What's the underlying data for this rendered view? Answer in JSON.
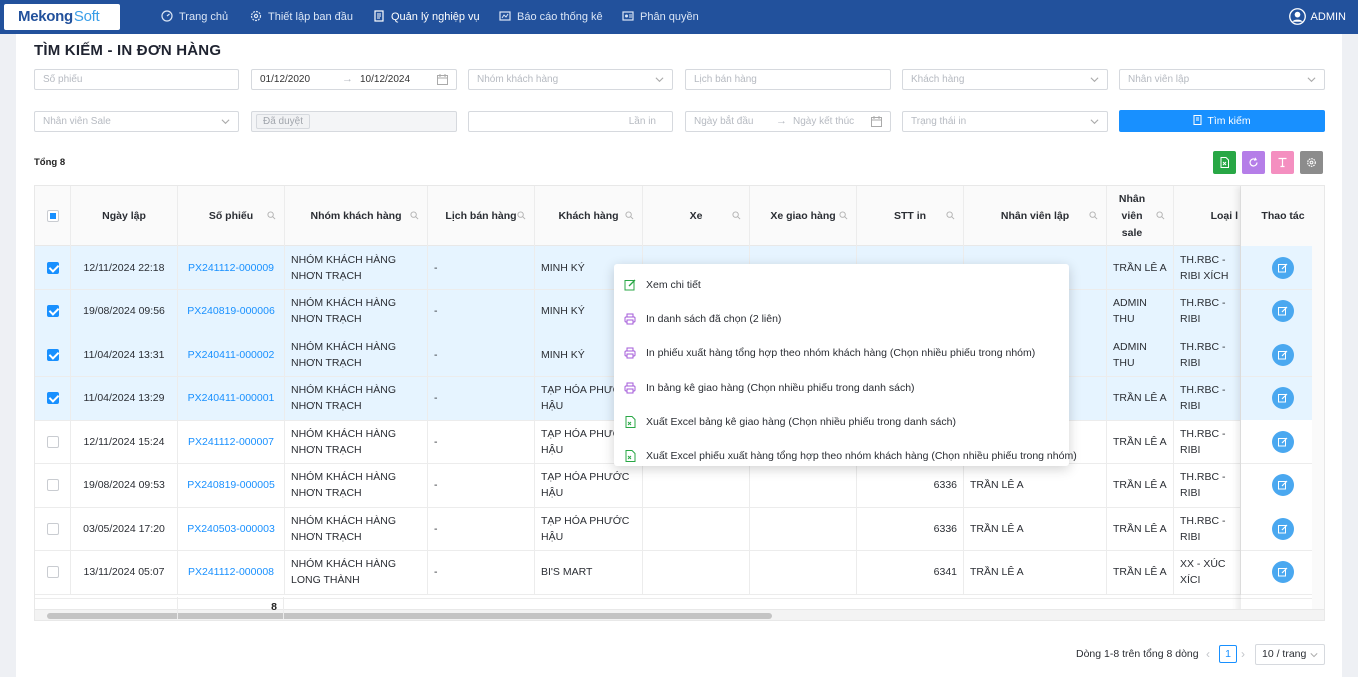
{
  "app": {
    "logo_main": "Mekong",
    "logo_soft": "Soft",
    "user": "ADMIN"
  },
  "nav": [
    {
      "label": "Trang chủ",
      "icon": "dashboard-icon"
    },
    {
      "label": "Thiết lập ban đầu",
      "icon": "settings-icon"
    },
    {
      "label": "Quản lý nghiệp vụ",
      "icon": "document-icon",
      "active": true
    },
    {
      "label": "Báo cáo thống kê",
      "icon": "report-icon"
    },
    {
      "label": "Phân quyền",
      "icon": "permission-icon"
    }
  ],
  "page": {
    "title": "TÌM KIẾM - IN ĐƠN HÀNG"
  },
  "filters": {
    "so_phieu": "Số phiếu",
    "date_from": "01/12/2020",
    "date_to": "10/12/2024",
    "nhom_khach_hang": "Nhóm khách hàng",
    "lich_ban_hang": "Lịch bán hàng",
    "khach_hang": "Khách hàng",
    "nhan_vien_lap": "Nhân viên lập",
    "nhan_vien_sale": "Nhân viên Sale",
    "trang_thai_duyet": "Đã duyệt",
    "lan_in": "Lần in",
    "ngay_bat_dau": "Ngày bắt đầu",
    "ngay_ket_thuc": "Ngày kết thúc",
    "trang_thai_in": "Trạng thái in",
    "search_button": "Tìm kiếm"
  },
  "summary": {
    "total_label": "Tổng 8"
  },
  "toolbar": {
    "colors": {
      "excel": "#28a745",
      "refresh": "#b57ee8",
      "text": "#f48fc0",
      "settings": "#8c8c8c"
    }
  },
  "table": {
    "headers": {
      "ngay_lap": "Ngày lập",
      "so_phieu": "Số phiếu",
      "nhom_khach_hang": "Nhóm khách hàng",
      "lich_ban_hang": "Lịch bán hàng",
      "khach_hang": "Khách hàng",
      "xe": "Xe",
      "xe_giao_hang": "Xe giao hàng",
      "stt_in": "STT in",
      "nhan_vien_lap": "Nhân viên lập",
      "nhan_vien_sale_1": "Nhân",
      "nhan_vien_sale_2": "viên",
      "nhan_vien_sale_3": "sale",
      "loai": "Loại l",
      "thao_tac": "Thao tác"
    },
    "rows": [
      {
        "checked": true,
        "ngay_lap": "12/11/2024 22:18",
        "so_phieu": "PX241112-000009",
        "nhom": "NHÓM KHÁCH HÀNG NHƠN TRẠCH",
        "lich": "-",
        "khach_hang": "MINH KÝ",
        "stt_in": "",
        "nv_lap": "",
        "nv_sale": "TRẦN LÊ A",
        "loai": "TH.RBC - RIBI XÍCH"
      },
      {
        "checked": true,
        "ngay_lap": "19/08/2024 09:56",
        "so_phieu": "PX240819-000006",
        "nhom": "NHÓM KHÁCH HÀNG NHƠN TRẠCH",
        "lich": "-",
        "khach_hang": "MINH KÝ",
        "stt_in": "",
        "nv_lap": "",
        "nv_sale": "ADMIN THU",
        "loai": "TH.RBC - RIBI"
      },
      {
        "checked": true,
        "ngay_lap": "11/04/2024 13:31",
        "so_phieu": "PX240411-000002",
        "nhom": "NHÓM KHÁCH HÀNG NHƠN TRẠCH",
        "lich": "-",
        "khach_hang": "MINH KÝ",
        "stt_in": "",
        "nv_lap": "",
        "nv_sale": "ADMIN THU",
        "loai": "TH.RBC - RIBI"
      },
      {
        "checked": true,
        "ngay_lap": "11/04/2024 13:29",
        "so_phieu": "PX240411-000001",
        "nhom": "NHÓM KHÁCH HÀNG NHƠN TRẠCH",
        "lich": "-",
        "khach_hang": "TẠP HÓA PHƯỚC HẬU",
        "stt_in": "",
        "nv_lap": "",
        "nv_sale": "TRẦN LÊ A",
        "loai": "TH.RBC - RIBI"
      },
      {
        "checked": false,
        "ngay_lap": "12/11/2024 15:24",
        "so_phieu": "PX241112-000007",
        "nhom": "NHÓM KHÁCH HÀNG NHƠN TRẠCH",
        "lich": "-",
        "khach_hang": "TẠP HÓA PHƯỚC HẬU",
        "stt_in": "",
        "nv_lap": "",
        "nv_sale": "TRẦN LÊ A",
        "loai": "TH.RBC - RIBI"
      },
      {
        "checked": false,
        "ngay_lap": "19/08/2024 09:53",
        "so_phieu": "PX240819-000005",
        "nhom": "NHÓM KHÁCH HÀNG NHƠN TRẠCH",
        "lich": "-",
        "khach_hang": "TẠP HÓA PHƯỚC HẬU",
        "stt_in": "6336",
        "nv_lap": "TRẦN LÊ A",
        "nv_sale": "TRẦN LÊ A",
        "loai": "TH.RBC - RIBI"
      },
      {
        "checked": false,
        "ngay_lap": "03/05/2024 17:20",
        "so_phieu": "PX240503-000003",
        "nhom": "NHÓM KHÁCH HÀNG NHƠN TRẠCH",
        "lich": "-",
        "khach_hang": "TẠP HÓA PHƯỚC HẬU",
        "stt_in": "6336",
        "nv_lap": "TRẦN LÊ A",
        "nv_sale": "TRẦN LÊ A",
        "loai": "TH.RBC - RIBI"
      },
      {
        "checked": false,
        "ngay_lap": "13/11/2024 05:07",
        "so_phieu": "PX241112-000008",
        "nhom": "NHÓM KHÁCH HÀNG LONG THÀNH",
        "lich": "-",
        "khach_hang": "BI'S MART",
        "stt_in": "6341",
        "nv_lap": "TRẦN LÊ A",
        "nv_sale": "TRẦN LÊ A",
        "loai": "XX - XÚC XÍCI"
      }
    ],
    "footer_count": "8"
  },
  "context_menu": [
    {
      "label": "Xem chi tiết",
      "icon": "edit-icon",
      "color": "#28a745"
    },
    {
      "label": "In danh sách đã chọn (2 liên)",
      "icon": "printer-icon",
      "color": "#a35ad8"
    },
    {
      "label": "In phiếu xuất hàng tổng hợp theo nhóm khách hàng (Chọn nhiều phiếu trong nhóm)",
      "icon": "printer-icon",
      "color": "#a35ad8"
    },
    {
      "label": "In bảng kê giao hàng (Chọn nhiều phiếu trong danh sách)",
      "icon": "printer-icon",
      "color": "#a35ad8"
    },
    {
      "label": "Xuất Excel bảng kê giao hàng (Chọn nhiều phiếu trong danh sách)",
      "icon": "excel-icon",
      "color": "#28a745"
    },
    {
      "label": "Xuất Excel phiếu xuất hàng tổng hợp theo nhóm khách hàng (Chọn nhiều phiếu trong nhóm)",
      "icon": "excel-icon",
      "color": "#28a745"
    }
  ],
  "pagination": {
    "summary": "Dòng 1-8 trên tổng 8 dòng",
    "current_page": "1",
    "page_size": "10 / trang"
  }
}
